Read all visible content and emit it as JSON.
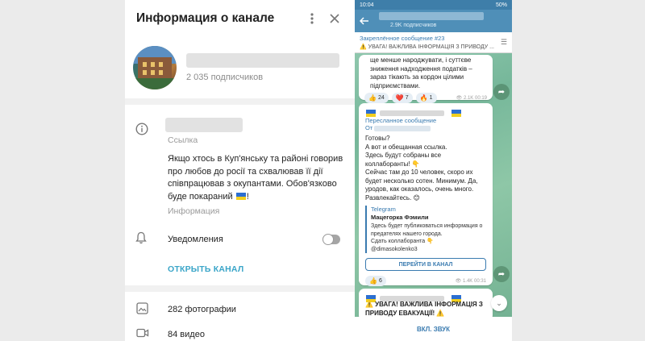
{
  "left_panel": {
    "title": "Информация о канале",
    "subscribers": "2 035 подписчиков",
    "link_label": "Ссылка",
    "description": "Якщо хтось в Куп'янську та районі говорив про любов до росії та схвалював її дії співпрацював з окупантами. Обов'язково буде покараний",
    "description_end": "!",
    "info_label": "Информация",
    "notifications_label": "Уведомления",
    "notifications_on": false,
    "open_channel": "ОТКРЫТЬ КАНАЛ",
    "media": [
      {
        "icon": "photo-icon",
        "label": "282 фотографии"
      },
      {
        "icon": "video-icon",
        "label": "84 видео"
      }
    ]
  },
  "phone": {
    "status_time": "10:04",
    "status_right": "50%",
    "subscribers": "2.9K подписчиков",
    "pinned_title": "Закреплённое сообщение #23",
    "pinned_text": "⚠️ УВАГА! ВАЖЛИВА ІНФОРМАЦІЯ З ПРИВОДУ ...",
    "msg1": {
      "text": "ще менше народжувати, і суттєве зниження надходження податків – зараз тікають за кордон цілими підприємствами.",
      "reactions": [
        {
          "emoji": "👍",
          "count": "24"
        },
        {
          "emoji": "❤️",
          "count": "7"
        },
        {
          "emoji": "🔥",
          "count": "1"
        }
      ],
      "views": "2.1K",
      "time": "00:19"
    },
    "msg2": {
      "forwarded_label": "Пересланное сообщение",
      "from_label": "От",
      "text": "Готовы?\nА вот и обещанная ссылка.\nЗдесь будут собраны все коллаборанты! 👇\nСейчас там до 10 человек, скоро их будет несколько сотен. Минимум. Да, уродов, как оказалось, очень много. Развлекайтесь. 😊",
      "preview_site": "Telegram",
      "preview_name": "Мацегорка Фэмили",
      "preview_desc": "Здесь будет публиковаться информация о предателях нашего города.\nСдать коллаборанта 👇\n@dimasokolenko3",
      "button": "ПЕРЕЙТИ В КАНАЛ",
      "reaction": {
        "emoji": "👍",
        "count": "6"
      },
      "views": "1.4K",
      "time": "00:31"
    },
    "msg3": {
      "text": "⚠️ УВАГА! ВАЖЛИВА ІНФОРМАЦІЯ З ПРИВОДУ ЕВАКУАЦІЇ! ⚠️"
    },
    "bottom_button": "ВКЛ. ЗВУК"
  },
  "colors": {
    "accent": "#3aa5c8",
    "phone_header": "#4f8fb8",
    "link_blue": "#3a7bb0",
    "chat_bg": "#8ec7a7"
  }
}
